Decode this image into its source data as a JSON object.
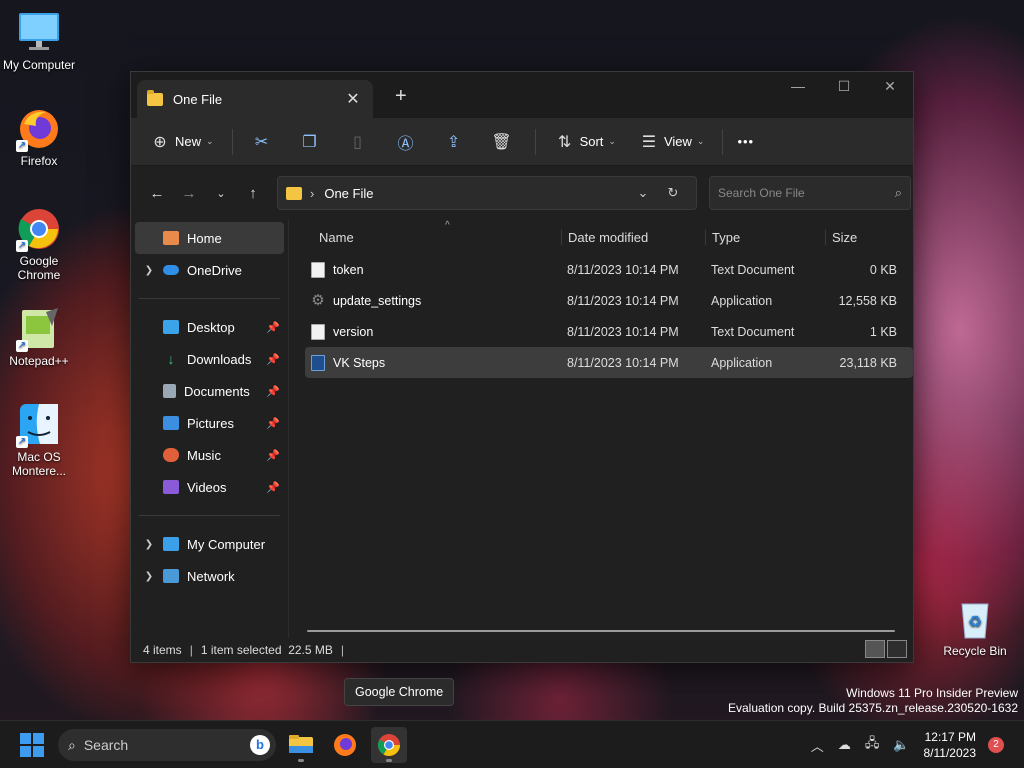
{
  "desktop": {
    "icons": [
      {
        "label": "My Computer",
        "icon": "monitor-icon"
      },
      {
        "label": "Firefox",
        "icon": "firefox-icon"
      },
      {
        "label": "Google Chrome",
        "icon": "chrome-icon"
      },
      {
        "label": "Notepad++",
        "icon": "notepadpp-icon"
      },
      {
        "label": "Mac OS Montere...",
        "icon": "finder-icon"
      },
      {
        "label": "Recycle Bin",
        "icon": "recycle-bin-icon"
      }
    ],
    "watermark_line1": "Windows 11 Pro Insider Preview",
    "watermark_line2": "Evaluation copy. Build 25375.zn_release.230520-1632",
    "tooltip": "Google Chrome"
  },
  "window": {
    "tab_title": "One File",
    "toolbar": {
      "new_label": "New",
      "sort_label": "Sort",
      "view_label": "View",
      "more_label": "•••"
    },
    "address": {
      "path": "One File",
      "search_placeholder": "Search One File"
    },
    "sidebar": {
      "items": [
        {
          "label": "Home"
        },
        {
          "label": "OneDrive"
        },
        {
          "label": "Desktop"
        },
        {
          "label": "Downloads"
        },
        {
          "label": "Documents"
        },
        {
          "label": "Pictures"
        },
        {
          "label": "Music"
        },
        {
          "label": "Videos"
        },
        {
          "label": "My Computer"
        },
        {
          "label": "Network"
        }
      ]
    },
    "columns": [
      "Name",
      "Date modified",
      "Type",
      "Size"
    ],
    "files": [
      {
        "name": "token",
        "date": "8/11/2023 10:14 PM",
        "type": "Text Document",
        "size": "0 KB"
      },
      {
        "name": "update_settings",
        "date": "8/11/2023 10:14 PM",
        "type": "Application",
        "size": "12,558 KB"
      },
      {
        "name": "version",
        "date": "8/11/2023 10:14 PM",
        "type": "Text Document",
        "size": "1 KB"
      },
      {
        "name": "VK Steps",
        "date": "8/11/2023 10:14 PM",
        "type": "Application",
        "size": "23,118 KB"
      }
    ],
    "status": {
      "items": "4 items",
      "selected": "1 item selected  22.5 MB"
    }
  },
  "taskbar": {
    "search_label": "Search",
    "time": "12:17 PM",
    "date": "8/11/2023",
    "notifications": "2"
  }
}
